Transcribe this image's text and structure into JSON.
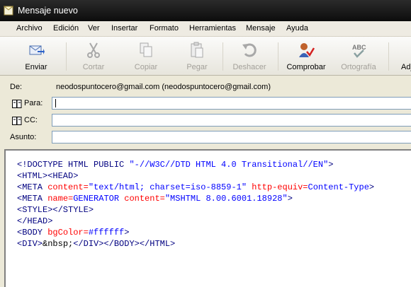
{
  "window": {
    "title": "Mensaje nuevo"
  },
  "menu": [
    "Archivo",
    "Edición",
    "Ver",
    "Insertar",
    "Formato",
    "Herramientas",
    "Mensaje",
    "Ayuda"
  ],
  "toolbar": {
    "send": "Enviar",
    "cut": "Cortar",
    "copy": "Copiar",
    "paste": "Pegar",
    "undo": "Deshacer",
    "check": "Comprobar",
    "spelling": "Ortografía",
    "attach": "Adj"
  },
  "headers": {
    "from_label": "De:",
    "from_value": "neodospuntocero@gmail.com     (neodospuntocero@gmail.com)",
    "to_label": "Para:",
    "cc_label": "CC:",
    "subject_label": "Asunto:",
    "to_value": "",
    "cc_value": "",
    "subject_value": ""
  },
  "source": {
    "l1_a": "<!DOCTYPE HTML PUBLIC ",
    "l1_b": "\"-//W3C//DTD HTML 4.0 Transitional//EN\"",
    "l1_c": ">",
    "l2": "<HTML><HEAD>",
    "l3_a": "<META ",
    "l3_b": "content=",
    "l3_c": "\"text/html; charset=iso-8859-1\"",
    "l3_d": " http-equiv=",
    "l3_e": "Content-Type",
    "l3_f": ">",
    "l4_a": "<META ",
    "l4_b": "name=",
    "l4_c": "GENERATOR",
    "l4_d": " content=",
    "l4_e": "\"MSHTML 8.00.6001.18928\"",
    "l4_f": ">",
    "l5": "<STYLE></STYLE>",
    "l6": "</HEAD>",
    "l7_a": "<BODY ",
    "l7_b": "bgColor=",
    "l7_c": "#ffffff",
    "l7_d": ">",
    "l8_a": "<DIV>",
    "l8_b": "&nbsp;",
    "l8_c": "</DIV></BODY></HTML>"
  },
  "colors": {
    "tag": "#000080",
    "attribute": "#ff0000",
    "value": "#0000ff"
  }
}
